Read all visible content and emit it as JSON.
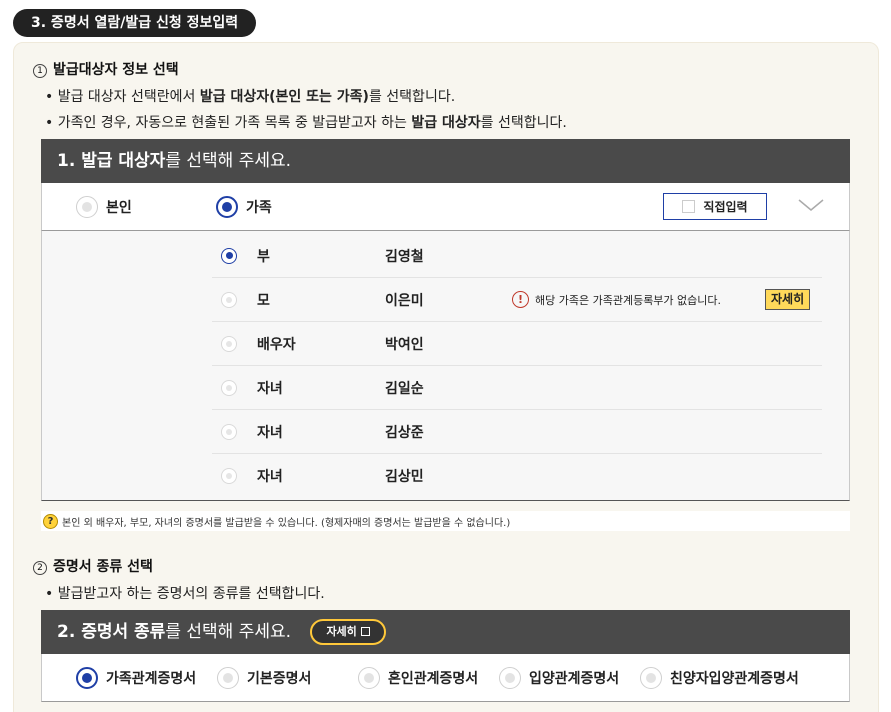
{
  "section": {
    "title": "3. 증명서 열람/발급 신청 정보입력"
  },
  "step1": {
    "num": "1",
    "title": "발급대상자 정보 선택",
    "bullet1": {
      "pre": "• 발급 대상자 선택란에서 ",
      "bold1": "발급 대상자(본인 또는 가족)",
      "post": "를 선택합니다."
    },
    "bullet2": {
      "pre": "• 가족인 경우, 자동으로 현출된 가족 목록 중 발급받고자 하는 ",
      "bold1": "발급 대상자",
      "post": "를 선택합니다."
    },
    "bar": {
      "bold": "1. 발급 대상자",
      "rest": "를 선택해 주세요."
    },
    "options": [
      {
        "label": "본인",
        "selected": false
      },
      {
        "label": "가족",
        "selected": true
      }
    ],
    "direct_input_label": "직접입력",
    "expand_icon": "chevron-down-icon",
    "family": [
      {
        "relation": "부",
        "name": "김영철",
        "selected": true
      },
      {
        "relation": "모",
        "name": "이은미",
        "selected": false,
        "warning": "해당 가족은 가족관계등록부가 없습니다.",
        "detail": "자세히"
      },
      {
        "relation": "배우자",
        "name": "박여인",
        "selected": false
      },
      {
        "relation": "자녀",
        "name": "김일순",
        "selected": false
      },
      {
        "relation": "자녀",
        "name": "김상준",
        "selected": false
      },
      {
        "relation": "자녀",
        "name": "김상민",
        "selected": false
      }
    ],
    "note": "본인 외 배우자, 부모, 자녀의 증명서를 발급받을 수 있습니다. (형제자매의 증명서는 발급받을 수 없습니다.)",
    "note_icon": "question-icon"
  },
  "step2": {
    "num": "2",
    "title": "증명서 종류 선택",
    "bullet1": "• 발급받고자 하는 증명서의 종류를 선택합니다.",
    "bar": {
      "bold": "2. 증명서 종류",
      "rest": "를 선택해 주세요.",
      "detail": "자세히"
    },
    "options": [
      {
        "label": "가족관계증명서",
        "selected": true
      },
      {
        "label": "기본증명서",
        "selected": false
      },
      {
        "label": "혼인관계증명서",
        "selected": false
      },
      {
        "label": "입양관계증명서",
        "selected": false
      },
      {
        "label": "친양자입양관계증명서",
        "selected": false
      }
    ]
  },
  "colors": {
    "accent": "#1f3fa6",
    "bar": "#4a4a4a",
    "highlight": "#ffd95a",
    "panel": "#f8f6ef"
  }
}
